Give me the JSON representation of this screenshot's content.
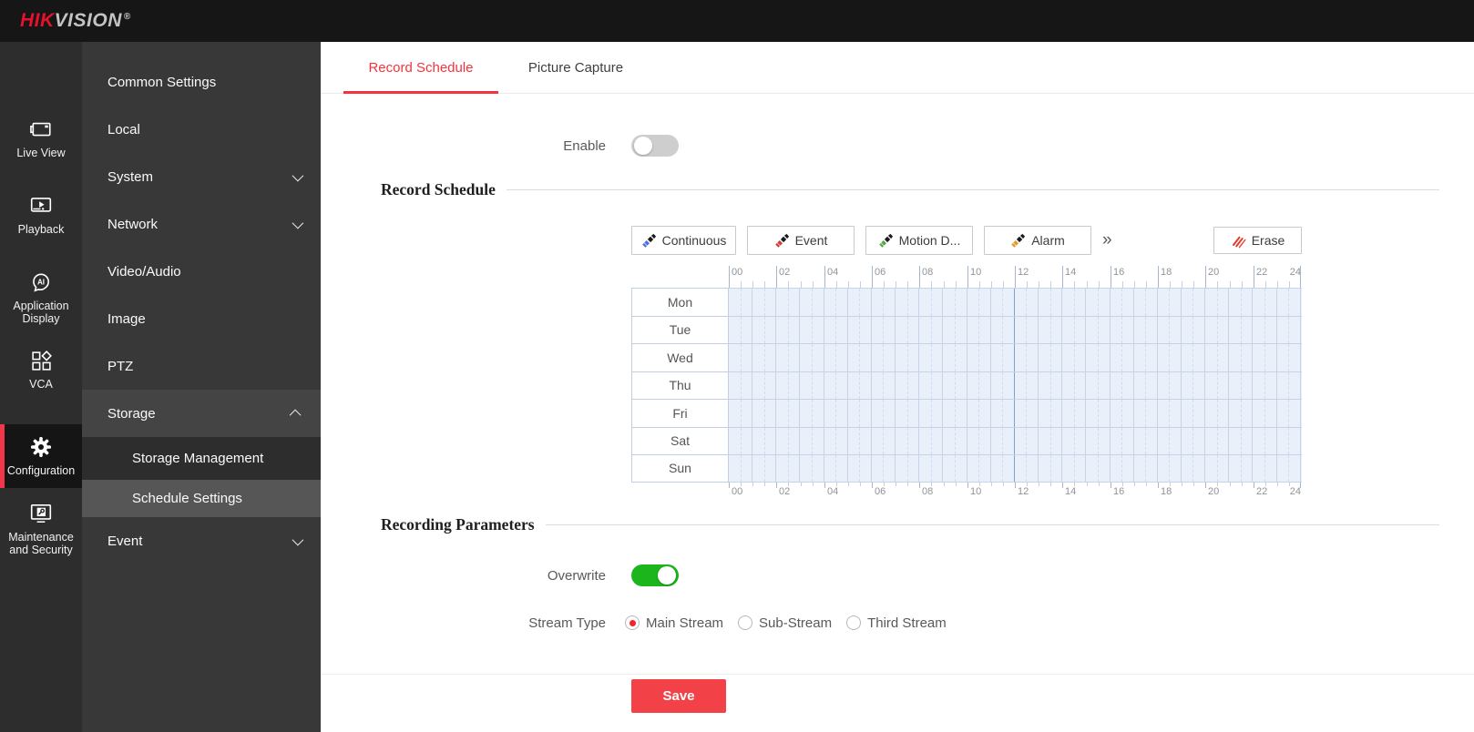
{
  "brand": {
    "hik": "HIK",
    "vision": "VISION",
    "reg": "®"
  },
  "colors": {
    "accent_red": "#f5333c",
    "save_red": "#f34247",
    "rail_active_bar": "#f4364c",
    "toggle_on_green": "#1cb51c",
    "toggle_off_gray": "#cecece",
    "grid_bg": "#eaf0f9",
    "grid_noon_line": "#79a1d6"
  },
  "nav_rail": {
    "items": [
      {
        "label": "Live View",
        "icon": "live-view-icon",
        "active": false
      },
      {
        "label": "Playback",
        "icon": "playback-icon",
        "active": false
      },
      {
        "label": "Application Display",
        "icon": "ai-head-icon",
        "active": false
      },
      {
        "label": "VCA",
        "icon": "vca-grid-icon",
        "active": false
      },
      {
        "label": "Configuration",
        "icon": "gear-icon",
        "active": true
      },
      {
        "label": "Maintenance and Security",
        "icon": "maintenance-icon",
        "active": false
      }
    ]
  },
  "side_menu": {
    "items": [
      {
        "label": "Common Settings"
      },
      {
        "label": "Local"
      },
      {
        "label": "System",
        "chevron": "down"
      },
      {
        "label": "Network",
        "chevron": "down"
      },
      {
        "label": "Video/Audio"
      },
      {
        "label": "Image"
      },
      {
        "label": "PTZ"
      },
      {
        "label": "Storage",
        "chevron": "up",
        "highlighted": true
      },
      {
        "label": "Storage Management",
        "sub": true
      },
      {
        "label": "Schedule Settings",
        "sub": true,
        "selected": true
      },
      {
        "label": "Event",
        "chevron": "down"
      }
    ]
  },
  "tabs": [
    {
      "label": "Record Schedule",
      "active": true
    },
    {
      "label": "Picture Capture",
      "active": false
    }
  ],
  "enable": {
    "label": "Enable",
    "state": "off"
  },
  "record_schedule": {
    "section_title": "Record Schedule",
    "type_buttons": [
      {
        "label": "Continuous",
        "color": "#4d6fe0"
      },
      {
        "label": "Event",
        "color": "#cd3e35"
      },
      {
        "label": "Motion D...",
        "color": "#54a844"
      },
      {
        "label": "Alarm",
        "color": "#e39a25"
      }
    ],
    "more_icon": "»",
    "erase": {
      "label": "Erase",
      "color": "#e23b2e"
    },
    "days": [
      "Mon",
      "Tue",
      "Wed",
      "Thu",
      "Fri",
      "Sat",
      "Sun"
    ],
    "hour_labels": [
      "00",
      "02",
      "04",
      "06",
      "08",
      "10",
      "12",
      "14",
      "16",
      "18",
      "20",
      "22",
      "24"
    ]
  },
  "recording_parameters": {
    "section_title": "Recording Parameters",
    "overwrite": {
      "label": "Overwrite",
      "state": "on"
    },
    "stream_type": {
      "label": "Stream Type",
      "options": [
        {
          "label": "Main Stream",
          "selected": true
        },
        {
          "label": "Sub-Stream",
          "selected": false
        },
        {
          "label": "Third Stream",
          "selected": false
        }
      ]
    }
  },
  "save": {
    "label": "Save"
  }
}
